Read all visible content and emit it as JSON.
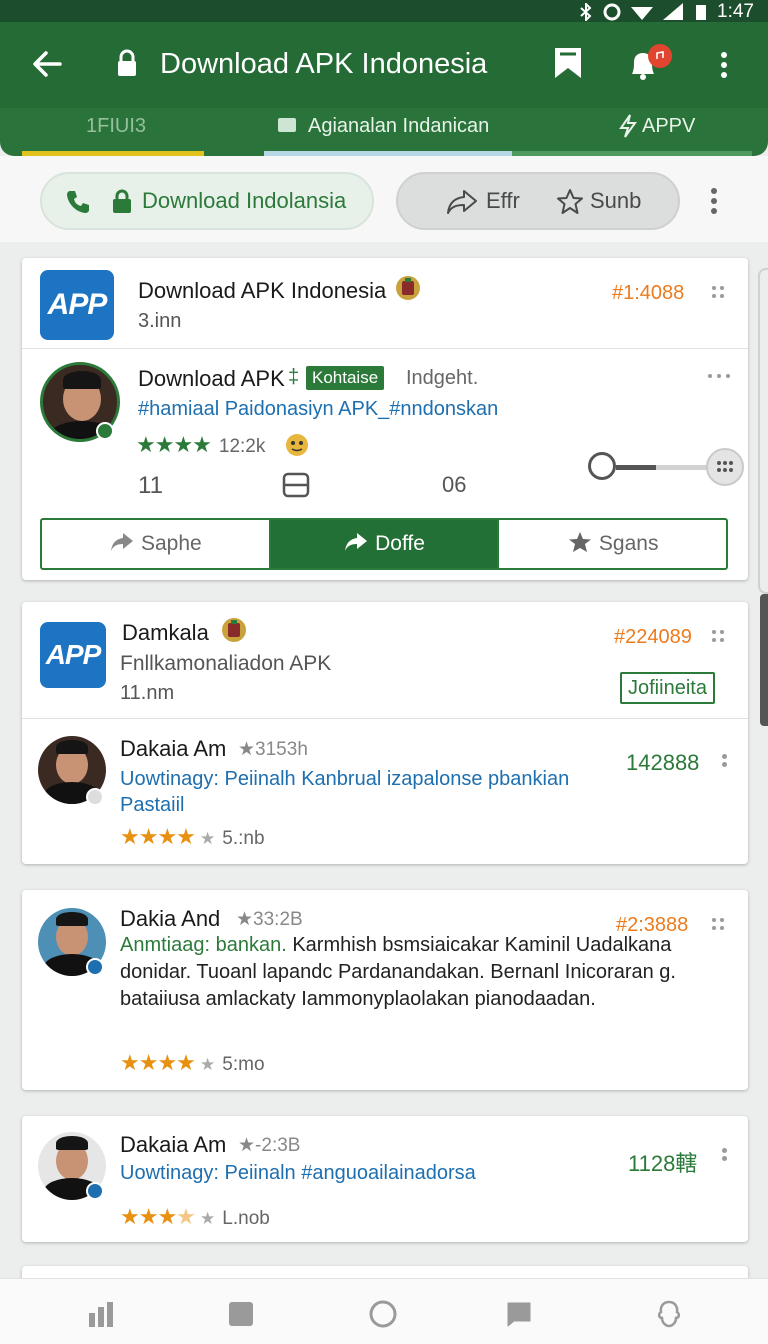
{
  "status_bar": {
    "time": "1:47"
  },
  "app_bar": {
    "title": "Download APK Indonesia",
    "notification_badge": ""
  },
  "sub_tabs": [
    {
      "label": "1FIUI3"
    },
    {
      "label": "Agianalan Indanican"
    },
    {
      "label": "APPV"
    }
  ],
  "filters": {
    "primary_chip": "Download Indolansia",
    "secondary_chip_a": "Effr",
    "secondary_chip_b": "Sunb"
  },
  "cards": [
    {
      "app": {
        "icon_text": "APP",
        "title": "Download APK Indonesia",
        "sub": "3.inn",
        "id": "#1:4088"
      },
      "post": {
        "author": "Download APK",
        "tag": "Kohtaise",
        "extra": "Indgeht.",
        "text": "#hamiaal Paidonasiyn APK_#nndonskan",
        "rating_meta": "12:2k",
        "stat_a": "11",
        "stat_b": "06"
      },
      "actions": [
        "Saphe",
        "Doffe",
        "Sgans"
      ]
    },
    {
      "app": {
        "icon_text": "APP",
        "title": "Damkala",
        "sub": "Fnllkamonaliadon APK",
        "sub2": "11.nm",
        "id": "#224089",
        "tag": "Jofiineita"
      },
      "post": {
        "author": "Dakaia Am",
        "meta": "3153h",
        "text": "Uowtinagy: Peiinalh Kanbrual izapalonse pbankian Pastaiil",
        "count": "142888",
        "rating_meta": "5.:nb"
      }
    },
    {
      "post": {
        "author": "Dakia And",
        "meta": "33:2B",
        "id": "#2:3888",
        "highlight": "Anmtiaag: bankan.",
        "text": " Karmhish bsmsiaicakar Kaminil Uadalkana donidar. Tuoanl lapandc Pardanandakan. Bernanl Inicoraran g. bataiiusa amlackaty Iammonyplaolakan pianodaadan.",
        "rating_meta": "5:mo"
      }
    },
    {
      "post": {
        "author": "Dakaia Am",
        "meta": "-2:3B",
        "text": "Uowtinagy: Peiinaln #anguoailainadorsa",
        "count": "1128轄",
        "rating_meta": "L.nob"
      }
    }
  ],
  "colors": {
    "app_bar": "#256b35",
    "accent_green": "#2b7a3a",
    "star": "#e8900f",
    "link_blue": "#1d6fb0",
    "id_orange": "#ec7b1e"
  },
  "icons": {
    "app_bar": [
      "arrow-left-icon",
      "lock-icon",
      "bookmark-icon",
      "bell-icon",
      "more-vert-icon"
    ],
    "bottom_nav": [
      "bar-chart-icon",
      "square-icon",
      "home-circle-icon",
      "chat-icon",
      "profile-icon"
    ]
  }
}
